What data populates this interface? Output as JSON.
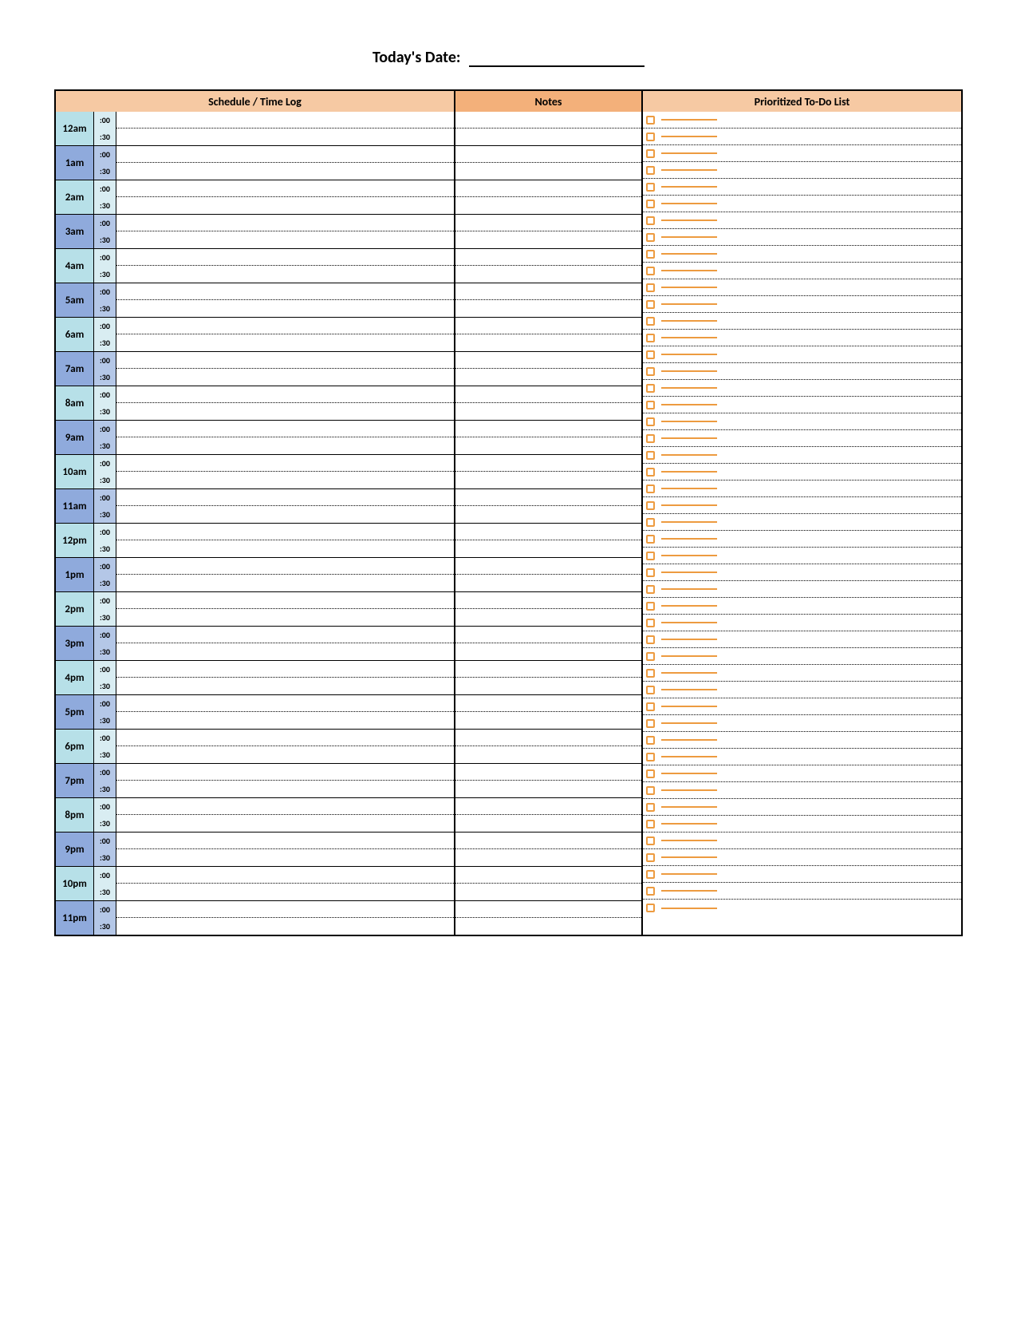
{
  "title": "Today's Date:",
  "headers": {
    "schedule": "Schedule / Time Log",
    "notes": "Notes",
    "todo": "Prioritized To-Do List"
  },
  "minute_labels": {
    "top": ":00",
    "bottom": ":30"
  },
  "hours": [
    {
      "label": "12am",
      "shade": "light"
    },
    {
      "label": "1am",
      "shade": "dark"
    },
    {
      "label": "2am",
      "shade": "light"
    },
    {
      "label": "3am",
      "shade": "dark"
    },
    {
      "label": "4am",
      "shade": "light"
    },
    {
      "label": "5am",
      "shade": "dark"
    },
    {
      "label": "6am",
      "shade": "light"
    },
    {
      "label": "7am",
      "shade": "dark"
    },
    {
      "label": "8am",
      "shade": "light"
    },
    {
      "label": "9am",
      "shade": "dark"
    },
    {
      "label": "10am",
      "shade": "light"
    },
    {
      "label": "11am",
      "shade": "dark"
    },
    {
      "label": "12pm",
      "shade": "light"
    },
    {
      "label": "1pm",
      "shade": "dark"
    },
    {
      "label": "2pm",
      "shade": "light"
    },
    {
      "label": "3pm",
      "shade": "dark"
    },
    {
      "label": "4pm",
      "shade": "light"
    },
    {
      "label": "5pm",
      "shade": "dark"
    },
    {
      "label": "6pm",
      "shade": "light"
    },
    {
      "label": "7pm",
      "shade": "dark"
    },
    {
      "label": "8pm",
      "shade": "light"
    },
    {
      "label": "9pm",
      "shade": "dark"
    },
    {
      "label": "10pm",
      "shade": "light"
    },
    {
      "label": "11pm",
      "shade": "dark"
    }
  ],
  "todo_line_count": 48,
  "colors": {
    "header_light": "#f6c9a3",
    "header_dark": "#f3b07a",
    "hour_light": "#b7e0e8",
    "hour_dark": "#8faadc",
    "min_light": "#d9edf2",
    "min_dark": "#b4c7e7",
    "accent_orange": "#ed9b40"
  }
}
